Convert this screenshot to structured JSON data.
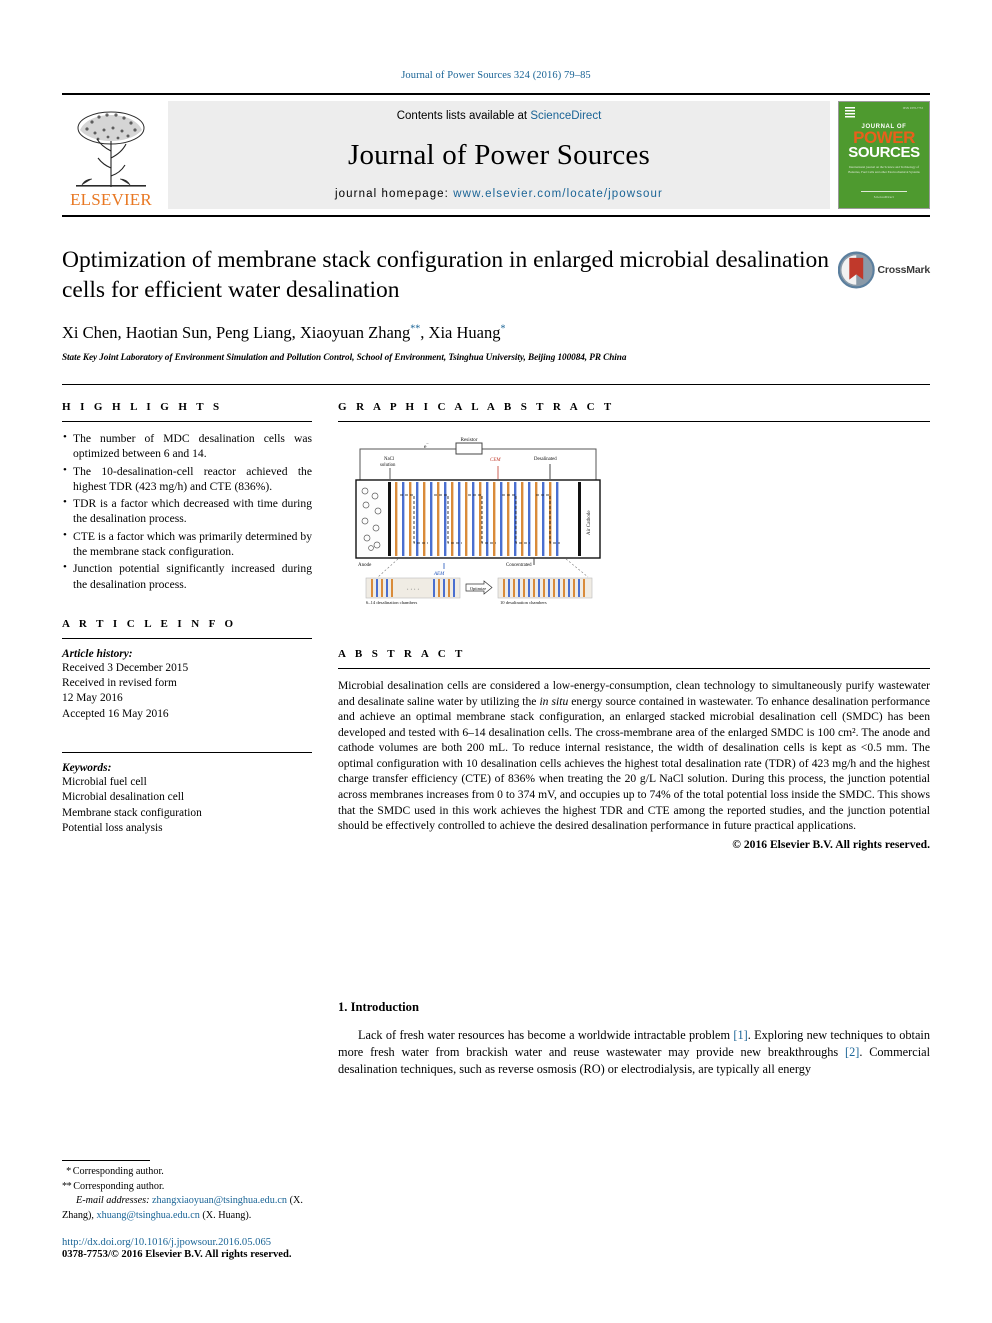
{
  "running_head": "Journal of Power Sources 324 (2016) 79–85",
  "masthead": {
    "publisher": "ELSEVIER",
    "contents_prefix": "Contents lists available at ",
    "contents_link": "ScienceDirect",
    "journal_name": "Journal of Power Sources",
    "homepage_label": "journal homepage: ",
    "homepage_url": "www.elsevier.com/locate/jpowsour",
    "cover": {
      "journal_of": "JOURNAL OF",
      "power": "POWER",
      "sources": "SOURCES",
      "blurb": "International journal on the Science and Technology of Batteries, Fuel Cells and other Electrochemical Systems",
      "footer": "ScienceDirect"
    }
  },
  "article": {
    "title": "Optimization of membrane stack configuration in enlarged microbial desalination cells for efficient water desalination",
    "authors": "Xi Chen, Haotian Sun, Peng Liang, Xiaoyuan Zhang",
    "authors_tail": ", Xia Huang",
    "author_mark_1": "**",
    "author_mark_2": "*",
    "affiliation": "State Key Joint Laboratory of Environment Simulation and Pollution Control, School of Environment, Tsinghua University, Beijing 100084, PR China",
    "crossmark_label": "CrossMark"
  },
  "highlights": {
    "heading": "H I G H L I G H T S",
    "items": [
      "The number of MDC desalination cells was optimized between 6 and 14.",
      "The 10-desalination-cell reactor achieved the highest TDR (423 mg/h) and CTE (836%).",
      "TDR is a factor which decreased with time during the desalination process.",
      "CTE is a factor which was primarily determined by the membrane stack configuration.",
      "Junction potential significantly increased during the desalination process."
    ]
  },
  "graphical_abstract": {
    "heading": "G R A P H I C A L  A B S T R A C T",
    "labels": {
      "electron": "e⁻",
      "resistor": "Resistor",
      "nacl": "NaCl solution",
      "cem": "CEM",
      "aem": "AEM",
      "desalinated": "Desalinated",
      "concentrated": "Concentrated",
      "anode": "Anode",
      "cathode": "Air Cathode",
      "before": "6–14 desalination chambers",
      "optimize": "Optimize",
      "after": "10 desalination chambers"
    },
    "colors": {
      "cem": "#c0392b",
      "aem": "#2255bb",
      "membrane_orange": "#d98b3a",
      "membrane_blue": "#4a6fd0"
    }
  },
  "article_info": {
    "heading": "A R T I C L E  I N F O",
    "history_title": "Article history:",
    "history": [
      "Received 3 December 2015",
      "Received in revised form",
      "12 May 2016",
      "Accepted 16 May 2016"
    ],
    "keywords_title": "Keywords:",
    "keywords": [
      "Microbial fuel cell",
      "Microbial desalination cell",
      "Membrane stack configuration",
      "Potential loss analysis"
    ]
  },
  "abstract": {
    "heading": "A B S T R A C T",
    "body": "Microbial desalination cells are considered a low-energy-consumption, clean technology to simultaneously purify wastewater and desalinate saline water by utilizing the in situ energy source contained in wastewater. To enhance desalination performance and achieve an optimal membrane stack configuration, an enlarged stacked microbial desalination cell (SMDC) has been developed and tested with 6–14 desalination cells. The cross-membrane area of the enlarged SMDC is 100 cm². The anode and cathode volumes are both 200 mL. To reduce internal resistance, the width of desalination cells is kept as <0.5 mm. The optimal configuration with 10 desalination cells achieves the highest total desalination rate (TDR) of 423 mg/h and the highest charge transfer efficiency (CTE) of 836% when treating the 20 g/L NaCl solution. During this process, the junction potential across membranes increases from 0 to 374 mV, and occupies up to 74% of the total potential loss inside the SMDC. This shows that the SMDC used in this work achieves the highest TDR and CTE among the reported studies, and the junction potential should be effectively controlled to achieve the desired desalination performance in future practical applications.",
    "copyright": "© 2016 Elsevier B.V. All rights reserved."
  },
  "introduction": {
    "heading": "1. Introduction",
    "paragraph_1": "Lack of fresh water resources has become a worldwide intractable problem [1]. Exploring new techniques to obtain more fresh water from brackish water and reuse wastewater may provide new breakthroughs [2]. Commercial desalination techniques, such as reverse osmosis (RO) or electrodialysis, are typically all energy"
  },
  "footer": {
    "corresponding_1": "Corresponding author.",
    "corresponding_2": "Corresponding author.",
    "email_label": "E-mail addresses:",
    "email_1": "zhangxiaoyuan@tsinghua.edu.cn",
    "email_1_name": "(X. Zhang),",
    "email_2": "xhuang@tsinghua.edu.cn",
    "email_2_name": "(X. Huang).",
    "doi": "http://dx.doi.org/10.1016/j.jpowsour.2016.05.065",
    "issn": "0378-7753/© 2016 Elsevier B.V. All rights reserved."
  }
}
